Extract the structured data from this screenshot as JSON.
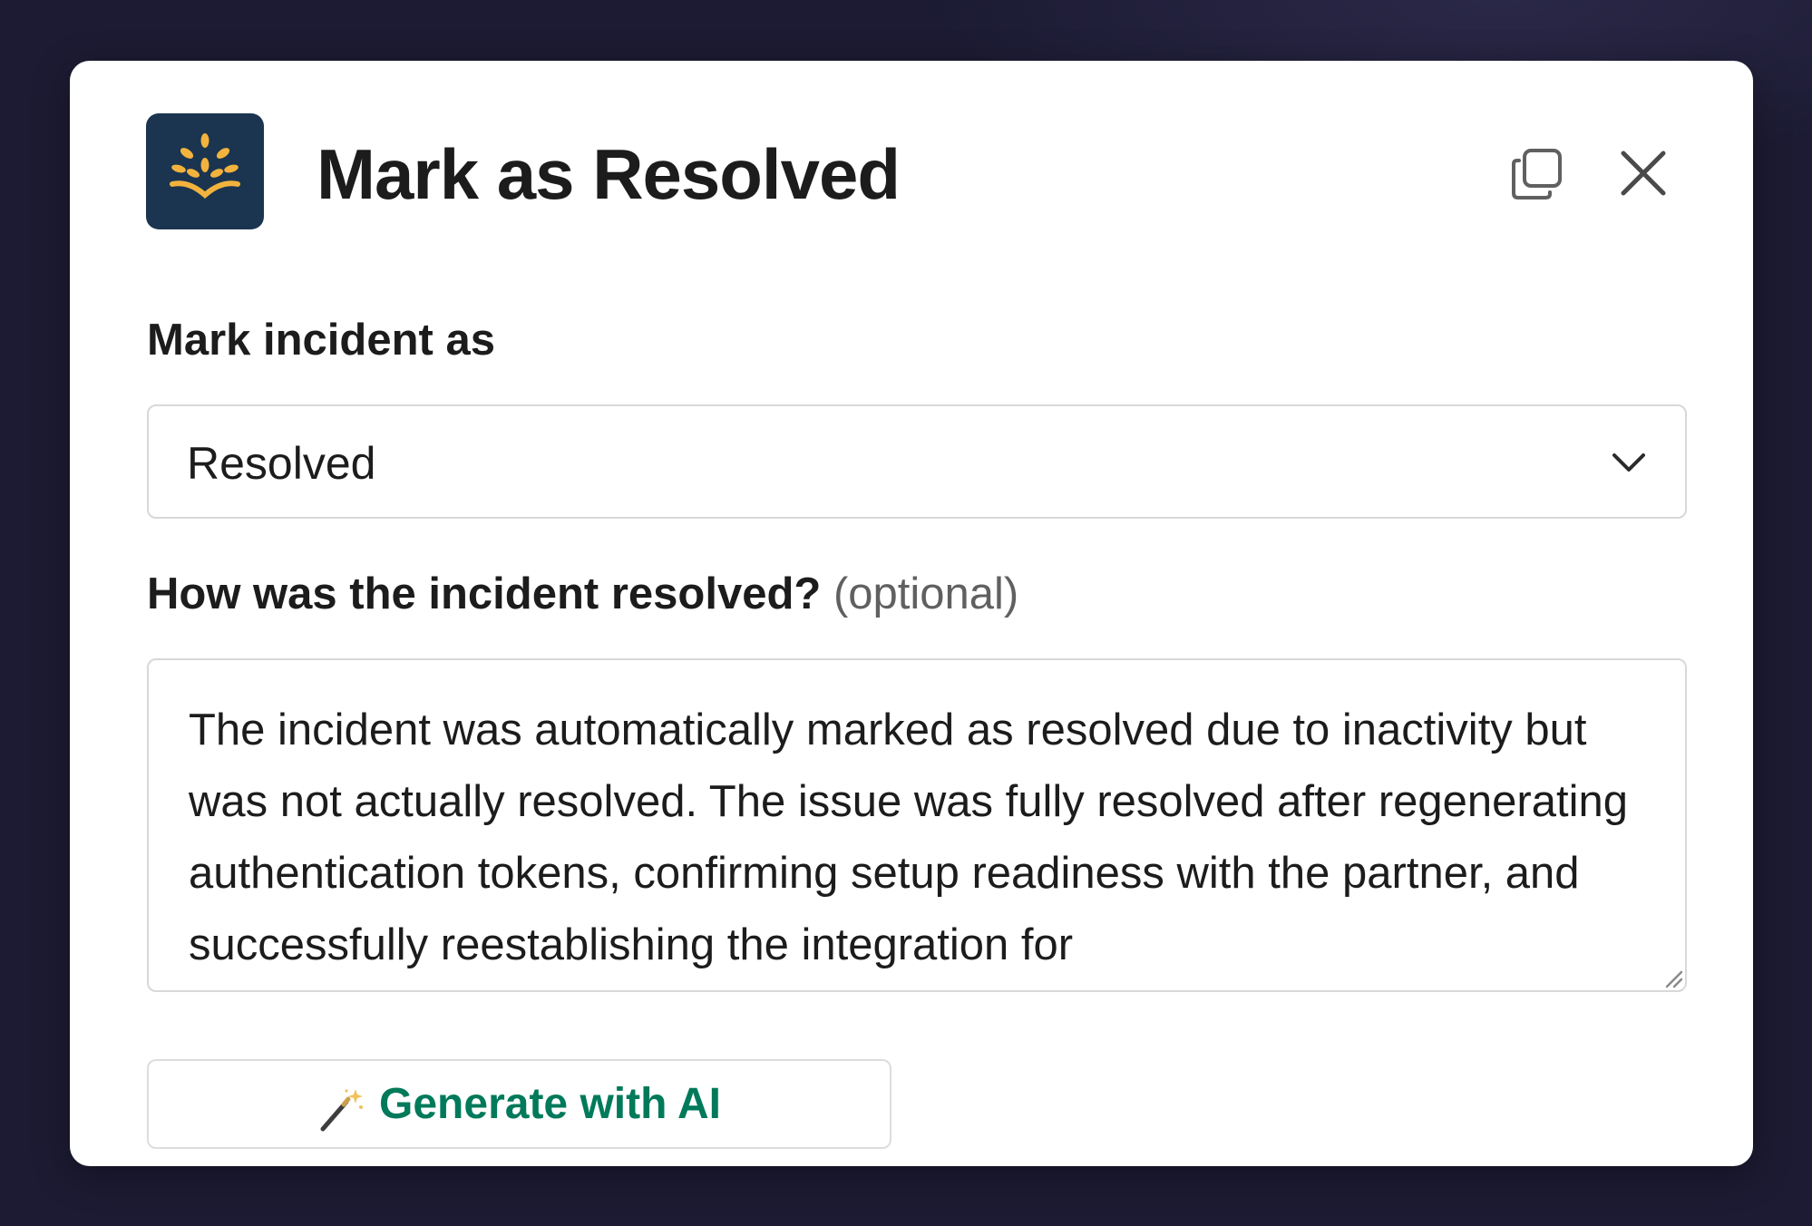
{
  "modal": {
    "title": "Mark as Resolved",
    "app_icon": "sprout-book-logo",
    "header_actions": [
      "copy-icon",
      "close-icon"
    ]
  },
  "status_field": {
    "label": "Mark incident as",
    "selected_value": "Resolved"
  },
  "resolution_field": {
    "label": "How was the incident resolved?",
    "optional_hint": "(optional)",
    "value": "The incident was automatically marked as resolved due to inactivity but was not actually resolved. The issue was fully resolved after regenerating authentication tokens, confirming setup readiness with the partner, and successfully reestablishing the integration for"
  },
  "ai_button": {
    "label": "Generate with AI",
    "icon": "magic-wand-icon",
    "label_color": "#007a5a"
  },
  "colors": {
    "logo_background": "#1b3550",
    "logo_accent": "#f2b33d",
    "backdrop": "#1c1b33"
  }
}
